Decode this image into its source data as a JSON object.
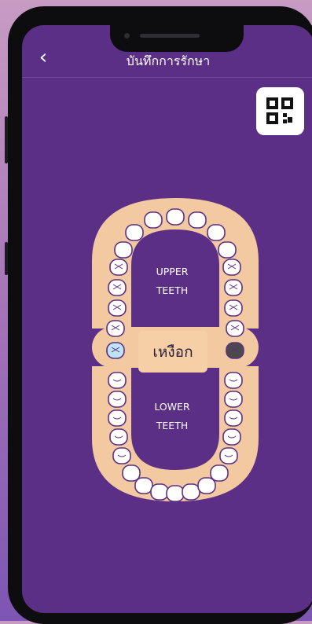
{
  "header": {
    "back_icon": "chevron-left-icon",
    "back_glyph": "‹",
    "title": "บันทึกการรักษา"
  },
  "qr_button": {
    "icon": "qr-code-icon"
  },
  "chart": {
    "gum_label": "เหงือก",
    "upper_label_1": "UPPER",
    "upper_label_2": "TEETH",
    "lower_label_1": "LOWER",
    "lower_label_2": "TEETH",
    "highlighted_teeth": {
      "upper_right_lateral": "selected-blue",
      "upper_left_lateral": "selected-dark"
    }
  },
  "colors": {
    "background": "#5c2f86",
    "gum": "#f2c9a0",
    "tooth": "#ffffff",
    "tooth_outline": "#5c2f86",
    "tooth_blue": "#bfe3f7",
    "tooth_dark": "#4a4a4a",
    "label_bg": "#f6cfa6"
  }
}
